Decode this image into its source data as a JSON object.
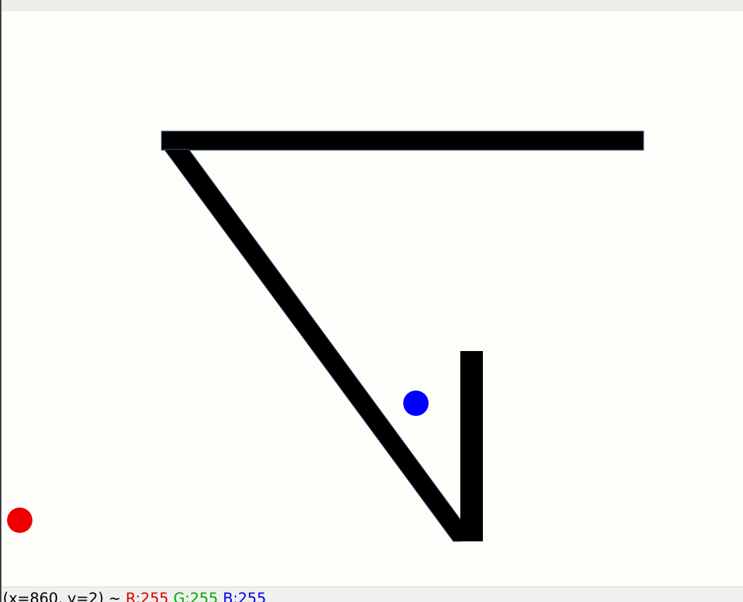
{
  "viewer": {
    "canvas_background": "#fdfdf9",
    "objects": [
      {
        "kind": "bar",
        "name": "top-bar",
        "color": "#000000"
      },
      {
        "kind": "bar",
        "name": "diagonal-bar",
        "color": "#000000"
      },
      {
        "kind": "bar",
        "name": "vertical-bar",
        "color": "#000000"
      },
      {
        "kind": "ball",
        "name": "blue-ball",
        "color": "#0000ff"
      },
      {
        "kind": "ball",
        "name": "red-ball",
        "color": "#ee0000"
      }
    ]
  },
  "status_bar": {
    "coords": "(x=860, y=2) ~",
    "r": "R:255",
    "g": "G:255",
    "b": "B:255",
    "r_color": "#dd0000",
    "g_color": "#00aa00",
    "b_color": "#0000ee"
  }
}
